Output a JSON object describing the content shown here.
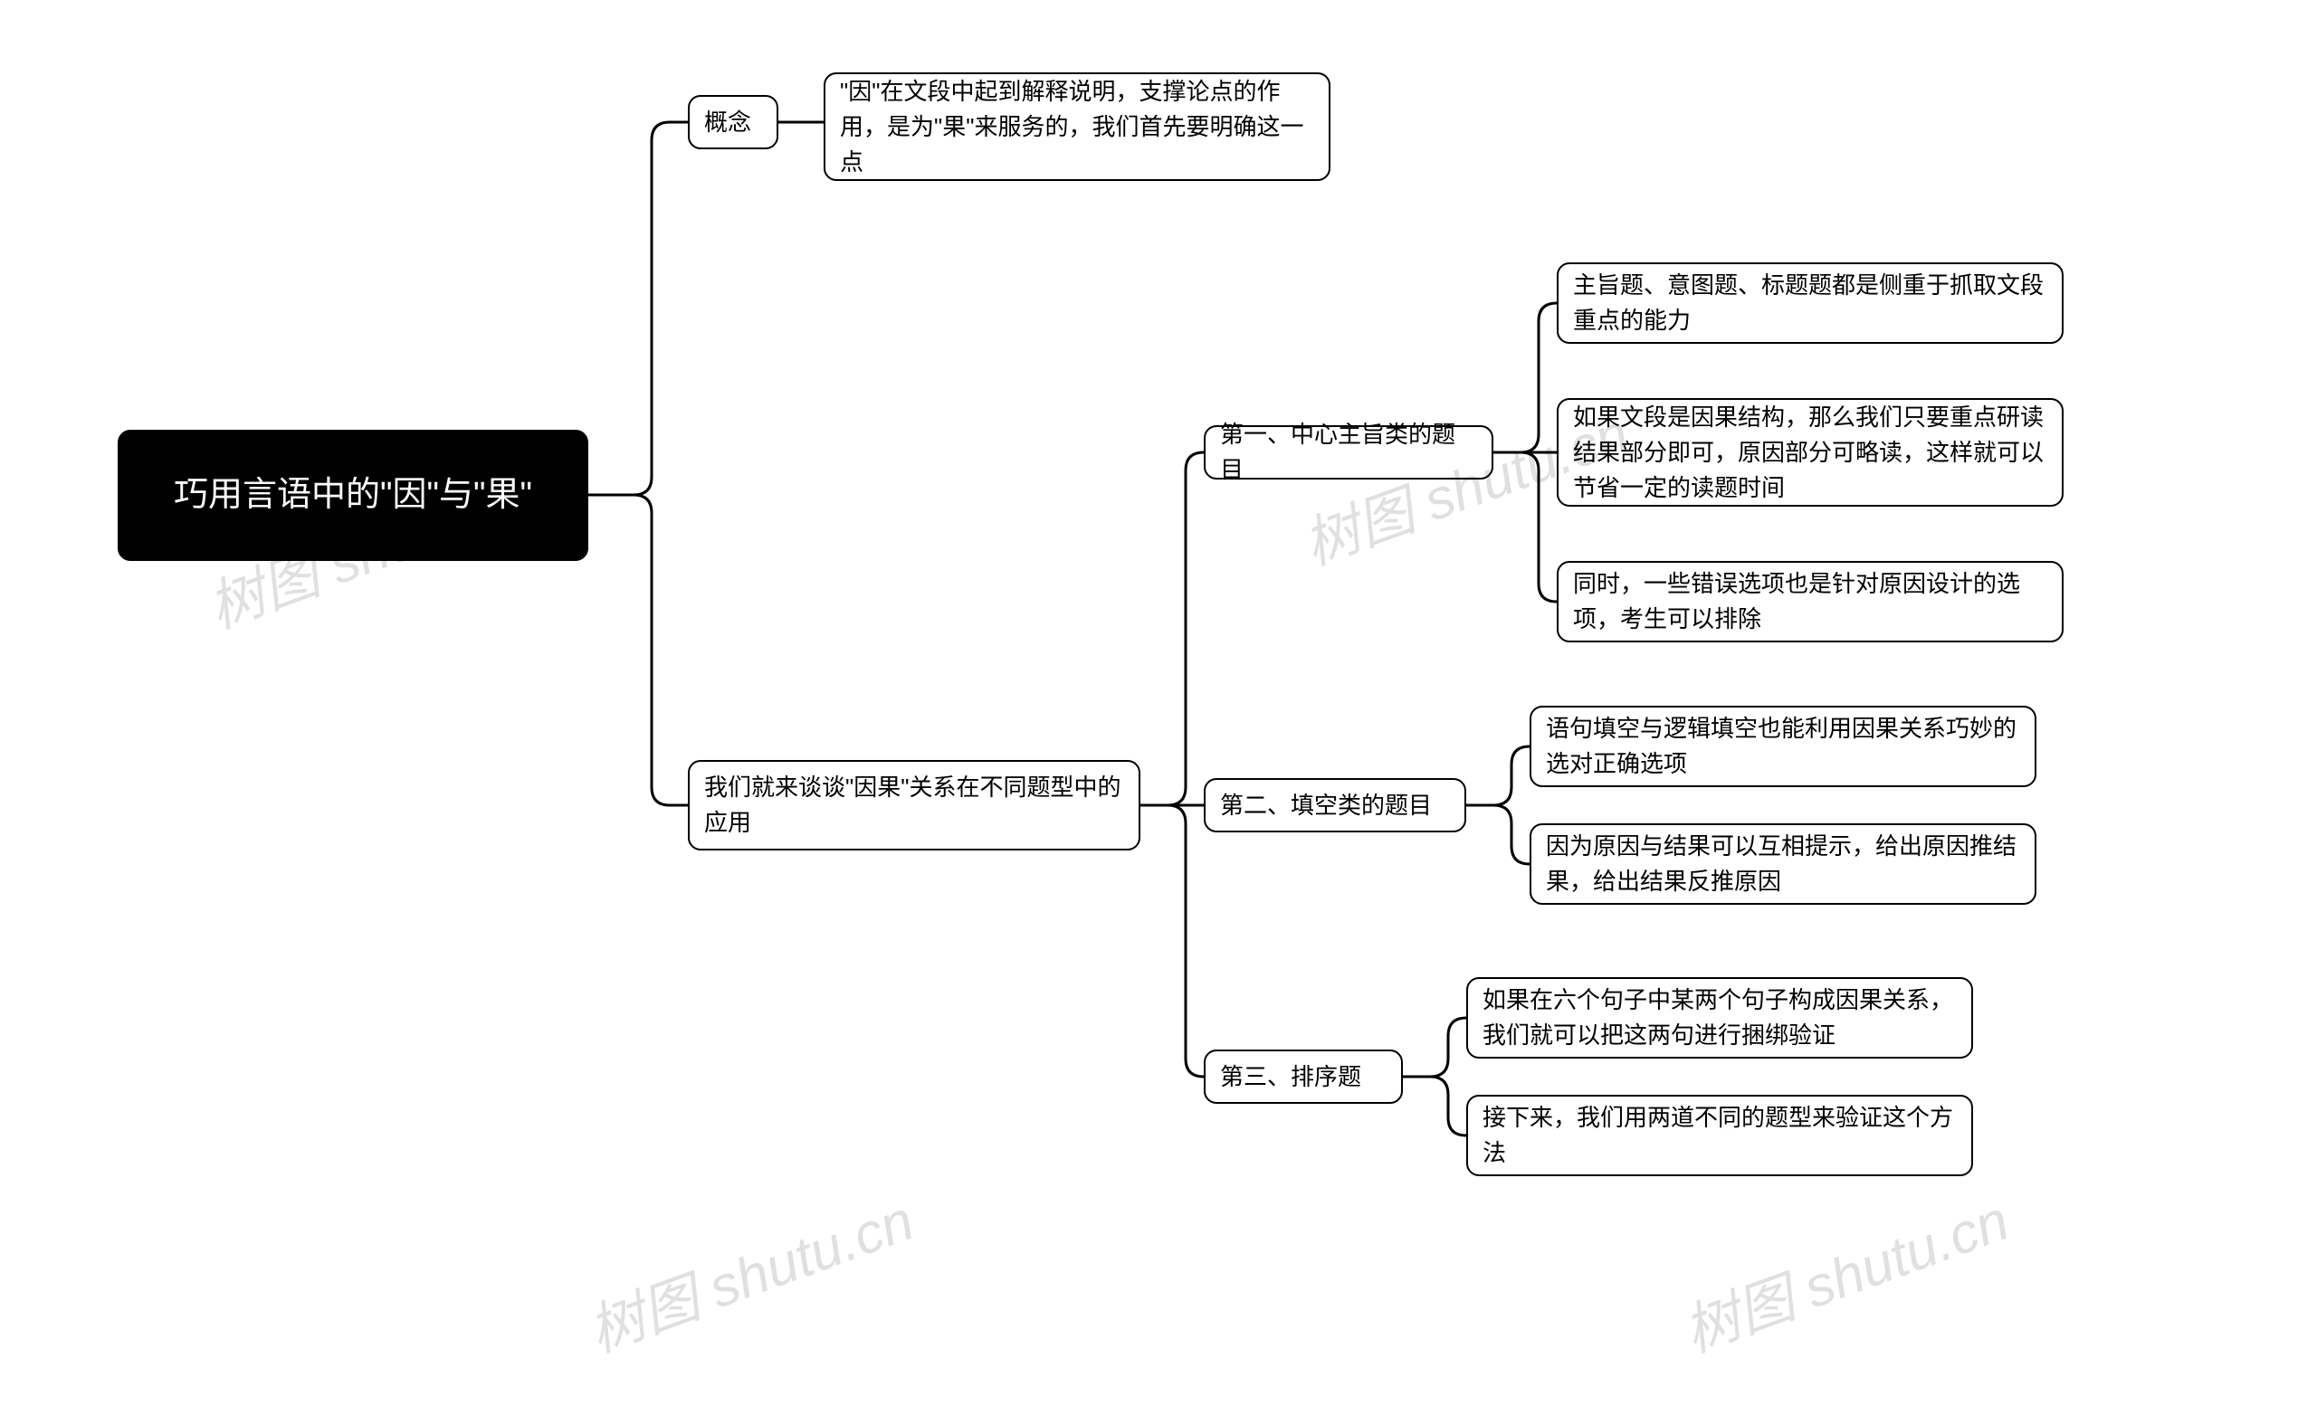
{
  "root": "巧用言语中的\"因\"与\"果\"",
  "branch1": {
    "title": "概念",
    "child": "\"因\"在文段中起到解释说明，支撑论点的作用，是为\"果\"来服务的，我们首先要明确这一点"
  },
  "branch2": {
    "title": "我们就来谈谈\"因果\"关系在不同题型中的应用",
    "sub1": {
      "title": "第一、中心主旨类的题目",
      "c1": "主旨题、意图题、标题题都是侧重于抓取文段重点的能力",
      "c2": "如果文段是因果结构，那么我们只要重点研读结果部分即可，原因部分可略读，这样就可以节省一定的读题时间",
      "c3": "同时，一些错误选项也是针对原因设计的选项，考生可以排除"
    },
    "sub2": {
      "title": "第二、填空类的题目",
      "c1": "语句填空与逻辑填空也能利用因果关系巧妙的选对正确选项",
      "c2": "因为原因与结果可以互相提示，给出原因推结果，给出结果反推原因"
    },
    "sub3": {
      "title": "第三、排序题",
      "c1": "如果在六个句子中某两个句子构成因果关系，我们就可以把这两句进行捆绑验证",
      "c2": "接下来，我们用两道不同的题型来验证这个方法"
    }
  },
  "watermark": "树图 shutu.cn"
}
